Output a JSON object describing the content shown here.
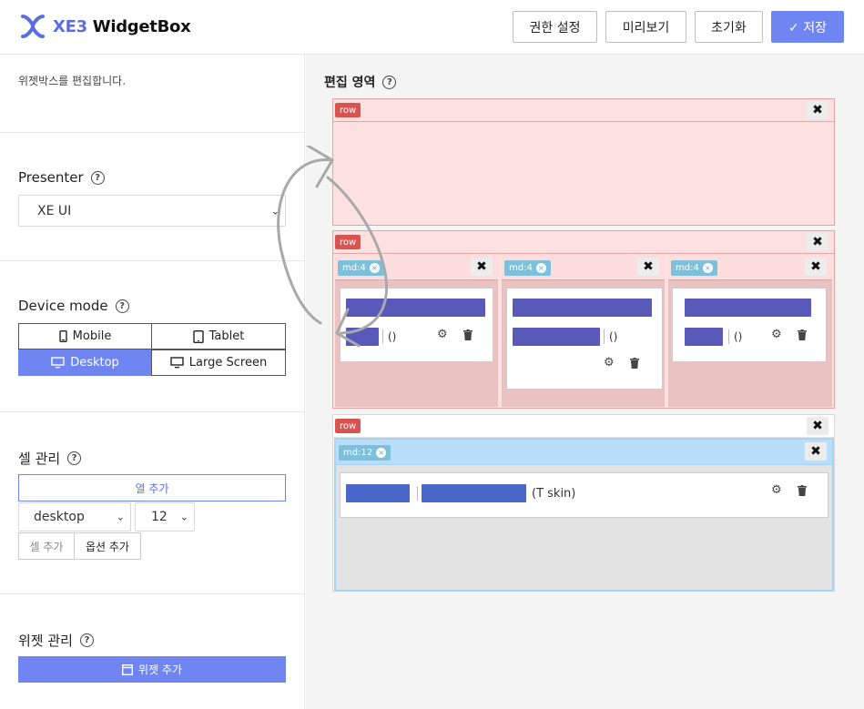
{
  "app": {
    "logo_brand": "XE3",
    "logo_name": " WidgetBox"
  },
  "toolbar": {
    "permissions_label": "권한 설정",
    "preview_label": "미리보기",
    "reset_label": "초기화",
    "save_label": "✓ 저장"
  },
  "left_panel": {
    "description": "위젯박스를 편집합니다.",
    "presenter": {
      "title": "Presenter",
      "selected": "XE UI"
    },
    "device_mode": {
      "title": "Device mode",
      "options": [
        "Mobile",
        "Tablet",
        "Desktop",
        "Large Screen"
      ],
      "active": "Desktop"
    },
    "cell_management": {
      "title": "셀 관리",
      "add_column_label": "열 추가",
      "device_select": "desktop",
      "size_select": "12",
      "add_cell_label": "셀 추가",
      "add_option_label": "옵션 추가"
    },
    "widget_management": {
      "title": "위젯 관리",
      "add_widget_label": "위젯 추가"
    }
  },
  "editor": {
    "title": "편집 영역",
    "rows": [
      {
        "badge": "row"
      },
      {
        "badge": "row",
        "columns": [
          {
            "badge": "md:4",
            "widget_paren": "()"
          },
          {
            "badge": "md:4",
            "widget_paren": "()"
          },
          {
            "badge": "md:4",
            "widget_paren": "()"
          }
        ]
      },
      {
        "badge": "row",
        "columns": [
          {
            "badge": "md:12",
            "widget_skin": "(T skin)"
          }
        ]
      }
    ]
  },
  "icons": {
    "help": "?",
    "close": "✖",
    "col_close": "×",
    "select_chevron": "⌄",
    "settings": "⚙",
    "trash": "🗑"
  },
  "colors": {
    "primary": "#6f86f2",
    "row_badge": "#d9534f",
    "col_badge": "#7cc0db",
    "widget_bar": "#5859b8",
    "row_bg": "#fde1e1"
  }
}
